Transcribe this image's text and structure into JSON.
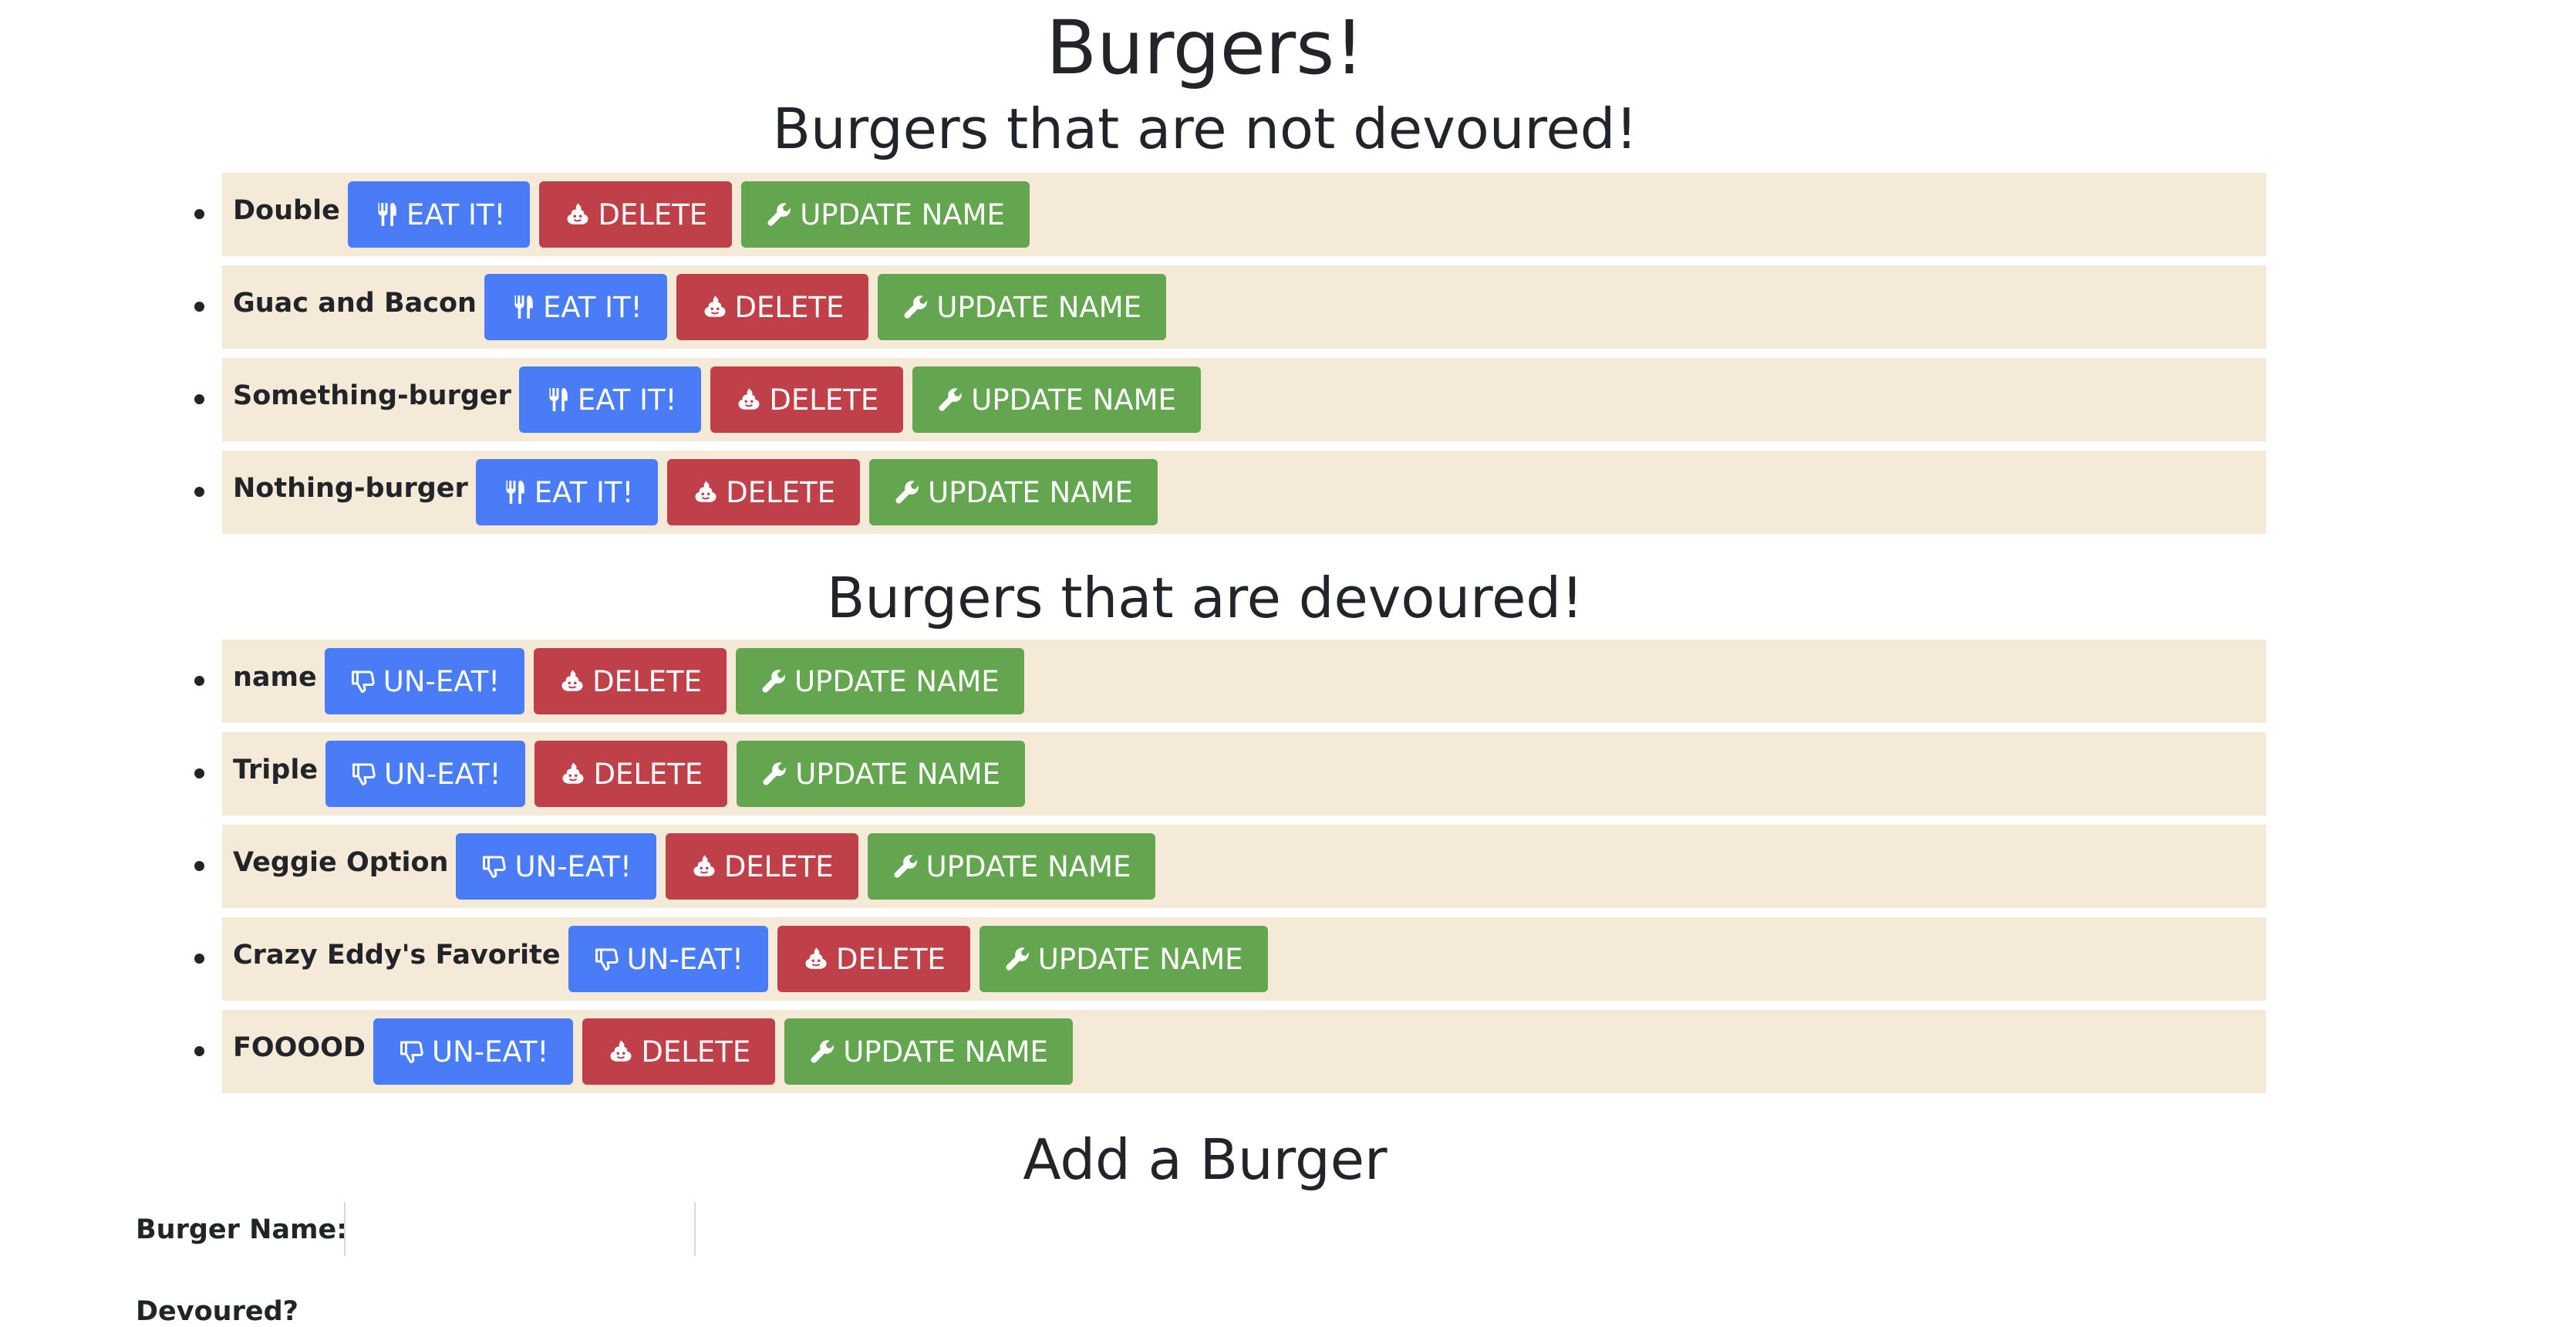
{
  "page": {
    "title": "Burgers!",
    "not_devoured_heading": "Burgers that are not devoured!",
    "devoured_heading": "Burgers that are devoured!",
    "add_heading": "Add a Burger"
  },
  "not_devoured": {
    "eat_label": "EAT IT!",
    "delete_label": "DELETE",
    "update_label": "UPDATE NAME",
    "items": [
      {
        "name": "Double"
      },
      {
        "name": "Guac and Bacon"
      },
      {
        "name": "Something-burger"
      },
      {
        "name": "Nothing-burger"
      }
    ]
  },
  "devoured": {
    "uneat_label": "UN-EAT!",
    "delete_label": "DELETE",
    "update_label": "UPDATE NAME",
    "items": [
      {
        "name": "name"
      },
      {
        "name": "Triple"
      },
      {
        "name": "Veggie Option"
      },
      {
        "name": "Crazy Eddy's Favorite"
      },
      {
        "name": "FOOOOD"
      }
    ]
  },
  "form": {
    "name_label": "Burger Name:",
    "name_value": "",
    "devoured_label": "Devoured?"
  },
  "colors": {
    "primary": "#4a7cf7",
    "danger": "#c0404a",
    "success": "#63a64f",
    "row_background": "#f5ead8"
  },
  "icons": {
    "eat": "utensils-icon",
    "uneat": "thumbs-down-icon",
    "delete": "poop-icon",
    "update": "wrench-icon"
  }
}
